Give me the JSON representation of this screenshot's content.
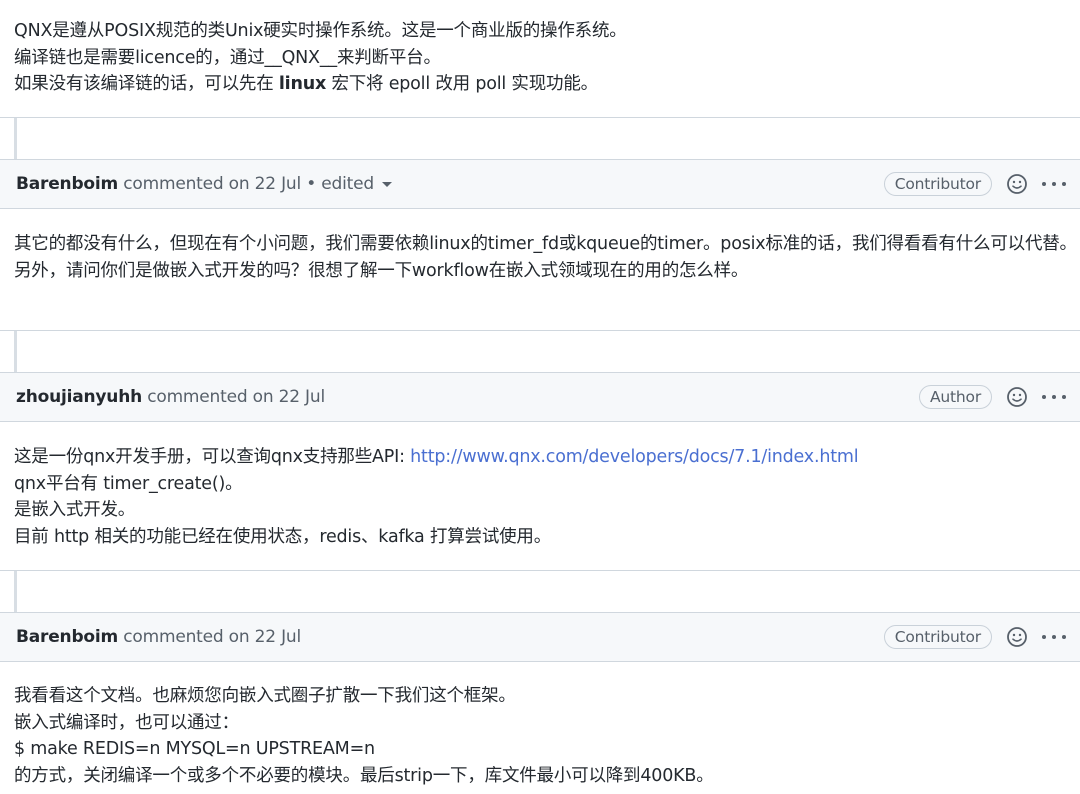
{
  "comment0": {
    "lines": [
      "QNX是遵从POSIX规范的类Unix硬实时操作系统。这是一个商业版的操作系统。",
      "编译链也是需要licence的，通过__QNX__来判断平台。"
    ],
    "line3_pre": "如果没有该编译链的话，可以先在 ",
    "line3_bold": "linux",
    "line3_post": " 宏下将 epoll 改用 poll 实现功能。"
  },
  "comment1": {
    "author": "Barenboim",
    "meta": "commented on 22 Jul",
    "edited": " • edited",
    "role": "Contributor",
    "line1": "其它的都没有什么，但现在有个小问题，我们需要依赖linux的timer_fd或kqueue的timer。posix标准的话，我们得看看有什么可以代替。",
    "line2": "另外，请问你们是做嵌入式开发的吗？很想了解一下workflow在嵌入式领域现在的用的怎么样。"
  },
  "comment2": {
    "author": "zhoujianyuhh",
    "meta": "commented on 22 Jul",
    "role": "Author",
    "line1_pre": "这是一份qnx开发手册，可以查询qnx支持那些API: ",
    "line1_link": "http://www.qnx.com/developers/docs/7.1/index.html",
    "line2": "qnx平台有 timer_create()。",
    "line3": "是嵌入式开发。",
    "line4": "目前 http 相关的功能已经在使用状态，redis、kafka 打算尝试使用。"
  },
  "comment3": {
    "author": "Barenboim",
    "meta": "commented on 22 Jul",
    "role": "Contributor",
    "line1": "我看看这个文档。也麻烦您向嵌入式圈子扩散一下我们这个框架。",
    "line2": "嵌入式编译时，也可以通过：",
    "line3": "$ make REDIS=n MYSQL=n UPSTREAM=n",
    "line4": "的方式，关闭编译一个或多个不必要的模块。最后strip一下，库文件最小可以降到400KB。"
  },
  "colors": {
    "link": "#4a6fd1",
    "text": "#24292f",
    "muted": "#57606a",
    "header_bg": "#f6f8fa",
    "border": "#d0d7de"
  }
}
